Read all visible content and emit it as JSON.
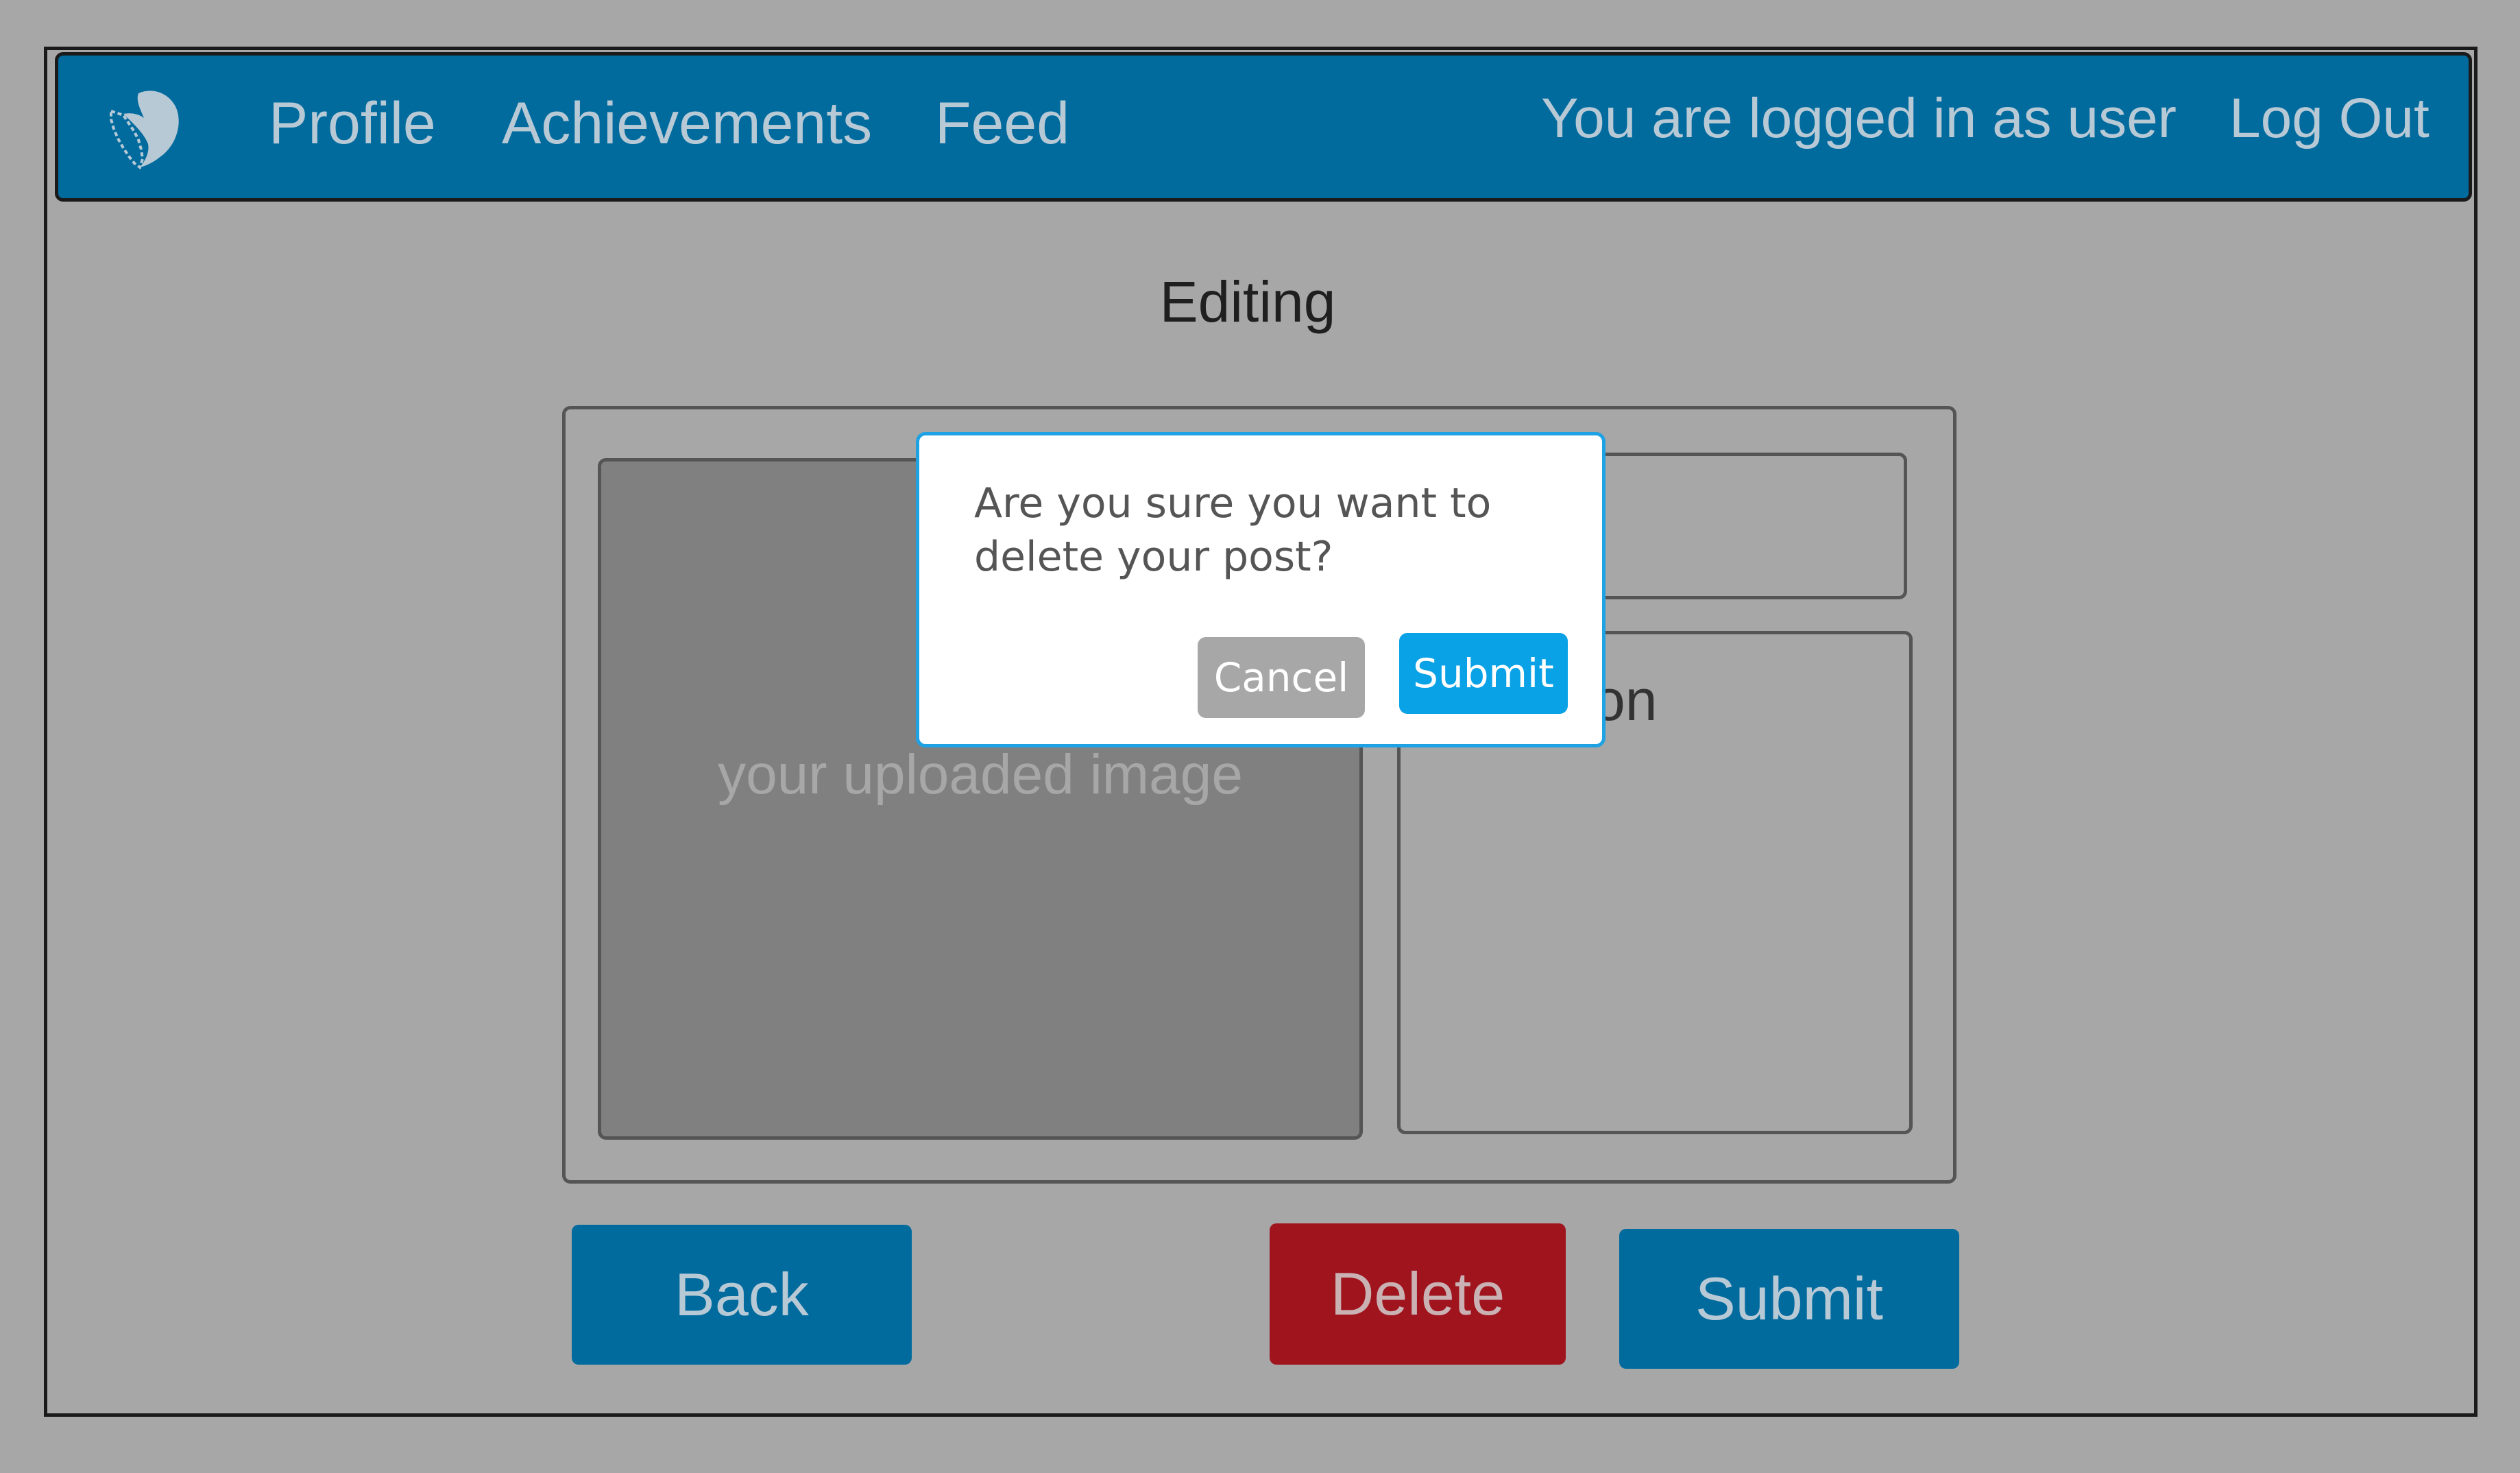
{
  "navbar": {
    "logo_icon": "bird-logo-icon",
    "links": [
      "Profile",
      "Achievements",
      "Feed"
    ],
    "status_text": "You are logged in as user",
    "logout_label": "Log Out",
    "background": "#016b9e"
  },
  "page": {
    "title": "Editing"
  },
  "editor": {
    "image_placeholder": "your uploaded image",
    "caption_label_visible": "tion"
  },
  "actions": {
    "back_label": "Back",
    "delete_label": "Delete",
    "submit_label": "Submit",
    "delete_color": "#a0141e"
  },
  "modal": {
    "message": "Are you sure you want to delete your post?",
    "cancel_label": "Cancel",
    "submit_label": "Submit",
    "border_color": "#1ea2e4"
  }
}
